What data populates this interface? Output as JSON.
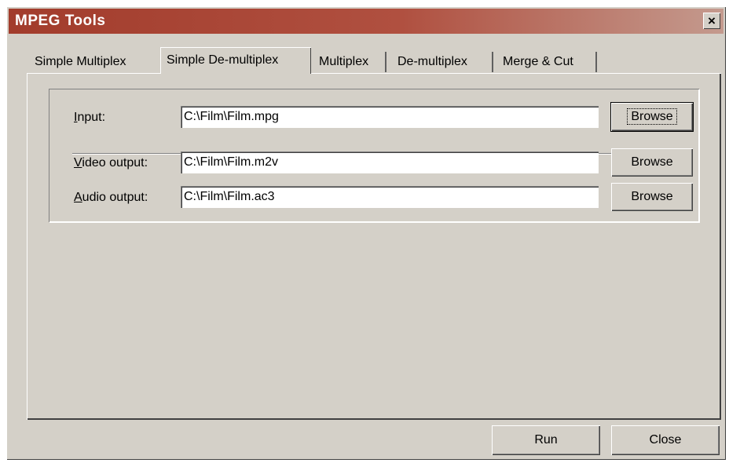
{
  "window": {
    "title": "MPEG Tools",
    "close_glyph": "×"
  },
  "tabs": [
    {
      "label": "Simple Multiplex",
      "active": false
    },
    {
      "label": "Simple De-multiplex",
      "active": true
    },
    {
      "label": "Multiplex",
      "active": false
    },
    {
      "label": "De-multiplex",
      "active": false
    },
    {
      "label": "Merge & Cut",
      "active": false
    }
  ],
  "fields": {
    "input": {
      "label_accel": "I",
      "label_rest": "nput:",
      "value": "C:\\Film\\Film.mpg",
      "browse_label": "Browse"
    },
    "video_output": {
      "label_accel": "V",
      "label_rest": "ideo output:",
      "value": "C:\\Film\\Film.m2v",
      "browse_label": "Browse"
    },
    "audio_output": {
      "label_accel": "A",
      "label_rest": "udio output:",
      "value": "C:\\Film\\Film.ac3",
      "browse_label": "Browse"
    }
  },
  "footer": {
    "run_label": "Run",
    "close_label": "Close"
  }
}
